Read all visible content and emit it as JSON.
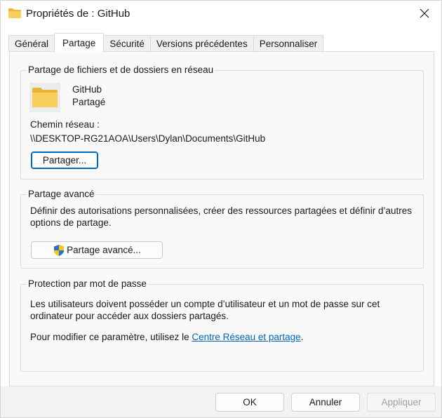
{
  "window": {
    "title": "Propriétés de : GitHub",
    "title_icon": "folder-icon",
    "close_icon": "close-icon"
  },
  "tabs": [
    {
      "label": "Général",
      "active": false
    },
    {
      "label": "Partage",
      "active": true
    },
    {
      "label": "Sécurité",
      "active": false
    },
    {
      "label": "Versions précédentes",
      "active": false
    },
    {
      "label": "Personnaliser",
      "active": false
    }
  ],
  "network_sharing": {
    "title": "Partage de fichiers et de dossiers en réseau",
    "folder_name": "GitHub",
    "folder_status": "Partagé",
    "network_path_label": "Chemin réseau :",
    "network_path": "\\\\DESKTOP-RG21AOA\\Users\\Dylan\\Documents\\GitHub",
    "share_button": "Partager..."
  },
  "advanced_sharing": {
    "title": "Partage avancé",
    "description": "Définir des autorisations personnalisées, créer des ressources partagées et définir d’autres options de partage.",
    "button": "Partage avancé...",
    "button_icon": "uac-shield-icon"
  },
  "password_protection": {
    "title": "Protection par mot de passe",
    "description": "Les utilisateurs doivent posséder un compte d’utilisateur et un mot de passe sur cet ordinateur pour accéder aux dossiers partagés.",
    "change_prefix": "Pour modifier ce paramètre, utilisez le ",
    "change_link": "Centre Réseau et partage",
    "change_suffix": "."
  },
  "footer": {
    "ok": "OK",
    "cancel": "Annuler",
    "apply": "Appliquer"
  },
  "colors": {
    "accent": "#0067c0",
    "folder": "#f6c94e",
    "disabled_text": "#a0a0a0"
  }
}
